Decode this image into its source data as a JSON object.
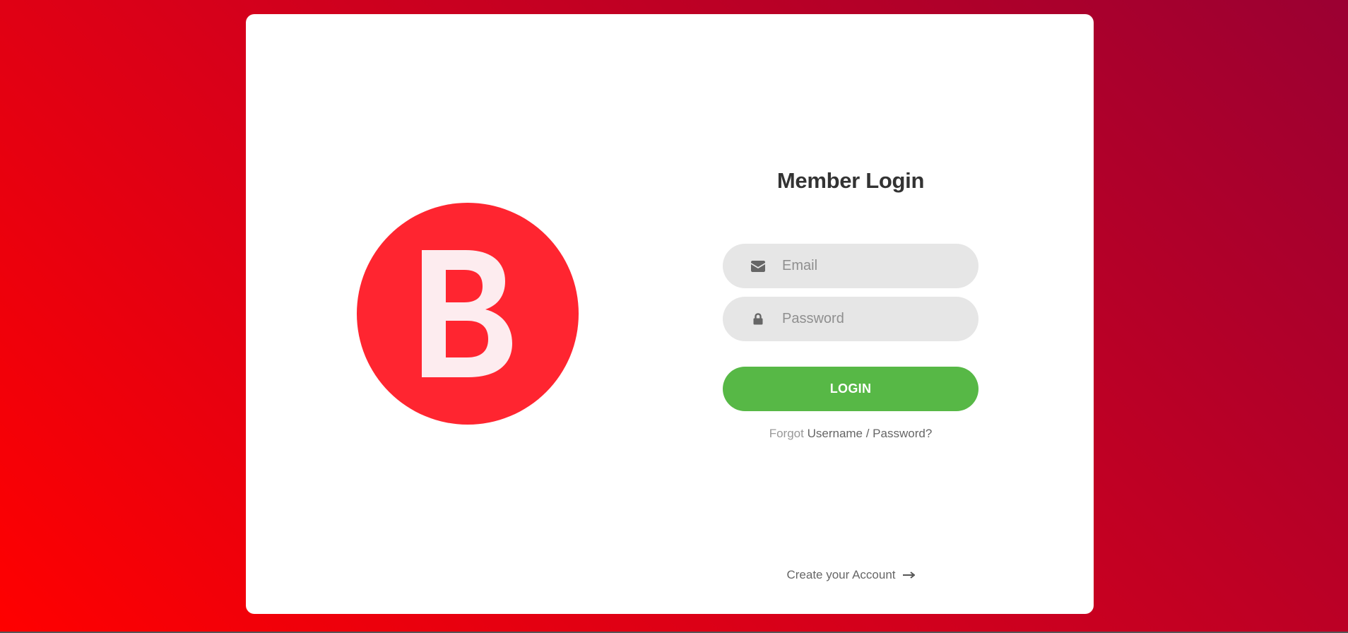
{
  "colors": {
    "background_start": "#ff0000",
    "background_end": "#9b0032",
    "card": "#ffffff",
    "logo_circle": "#ff2530",
    "logo_letter": "#fdecef",
    "input_bg": "#e6e6e6",
    "login_button": "#57b846",
    "title": "#333333"
  },
  "logo": {
    "letter": "B",
    "icon": "brand-logo-b"
  },
  "login": {
    "title": "Member Login",
    "email": {
      "placeholder": "Email",
      "value": "",
      "icon": "envelope-icon"
    },
    "password": {
      "placeholder": "Password",
      "value": "",
      "icon": "lock-icon"
    },
    "submit_label": "LOGIN",
    "forgot_prefix": "Forgot",
    "forgot_link": "Username / Password?",
    "create_account_label": "Create your Account",
    "create_account_icon": "arrow-right-icon"
  }
}
